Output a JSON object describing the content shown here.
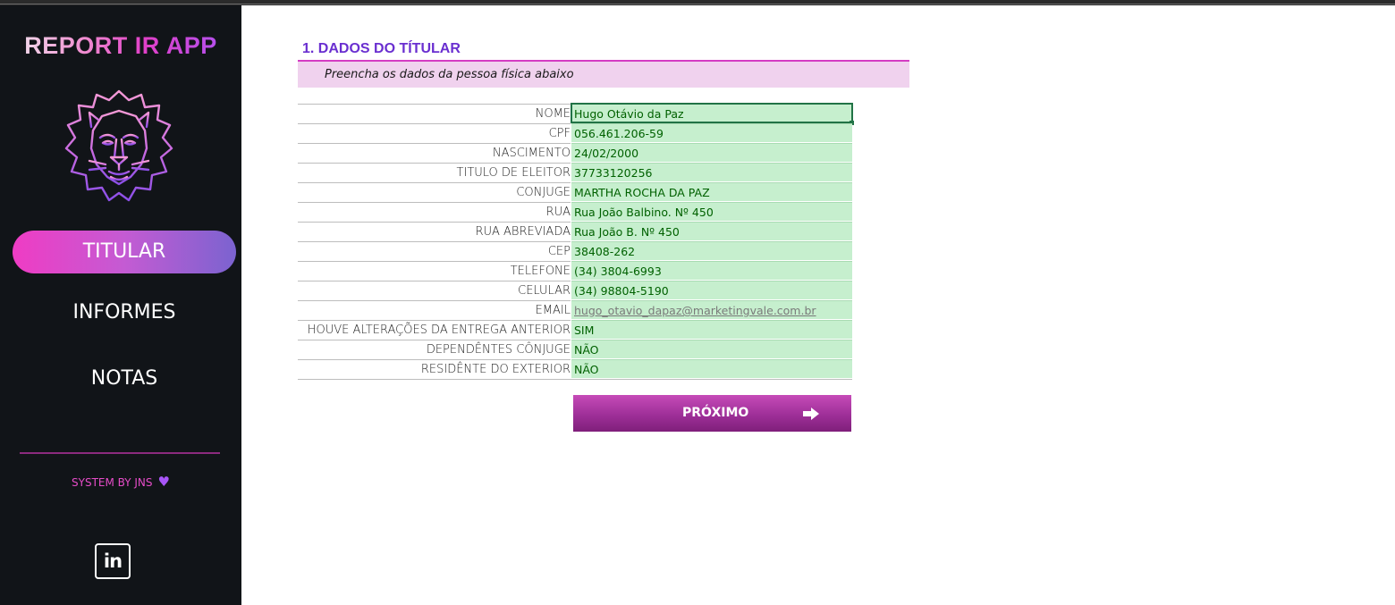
{
  "sidebar": {
    "app_title": "REPORT IR APP",
    "nav": [
      {
        "label": "TITULAR",
        "active": true
      },
      {
        "label": "INFORMES",
        "active": false
      },
      {
        "label": "NOTAS",
        "active": false
      }
    ],
    "credit": "SYSTEM BY JNS",
    "credit_icon": "purple-heart-icon",
    "social_icon": "linkedin-icon",
    "social_text": "in",
    "logo_icon": "lion-head-icon",
    "colors": {
      "background": "#111418",
      "accent_pink": "#ef3cc4",
      "accent_purple": "#7b63d0"
    }
  },
  "main": {
    "section_title": "1. DADOS DO TÍTULAR",
    "subtitle": "Preencha os dados da pessoa física abaixo",
    "fields": [
      {
        "label": "NOME",
        "value": "Hugo Otávio da Paz"
      },
      {
        "label": "CPF",
        "value": "056.461.206-59"
      },
      {
        "label": "NASCIMENTO",
        "value": "24/02/2000"
      },
      {
        "label": "TITULO DE ELEITOR",
        "value": "37733120256"
      },
      {
        "label": "CONJUGE",
        "value": "MARTHA ROCHA DA PAZ"
      },
      {
        "label": "RUA",
        "value": "Rua João Balbino. Nº 450"
      },
      {
        "label": "RUA ABREVIADA",
        "value": "Rua João B. Nº 450"
      },
      {
        "label": "CEP",
        "value": "38408-262"
      },
      {
        "label": "TELEFONE",
        "value": "(34) 3804-6993"
      },
      {
        "label": "CELULAR",
        "value": "(34) 98804-5190"
      },
      {
        "label": "EMAIL",
        "value": "hugo_otavio_dapaz@marketingvale.com.br"
      },
      {
        "label": "HOUVE ALTERAÇÕES DA ENTREGA ANTERIOR",
        "value": "SIM"
      },
      {
        "label": "DEPENDÊNTES CÔNJUGE",
        "value": "NÃO"
      },
      {
        "label": "RESIDÊNTE DO EXTERIOR",
        "value": "NÃO"
      }
    ],
    "next_button": {
      "label": "PRÓXIMO",
      "icon": "arrow-right-icon"
    },
    "colors": {
      "value_bg": "#c6efce",
      "value_text": "#006100",
      "title": "#6a2fd0",
      "band": "#f0d2ee"
    }
  }
}
